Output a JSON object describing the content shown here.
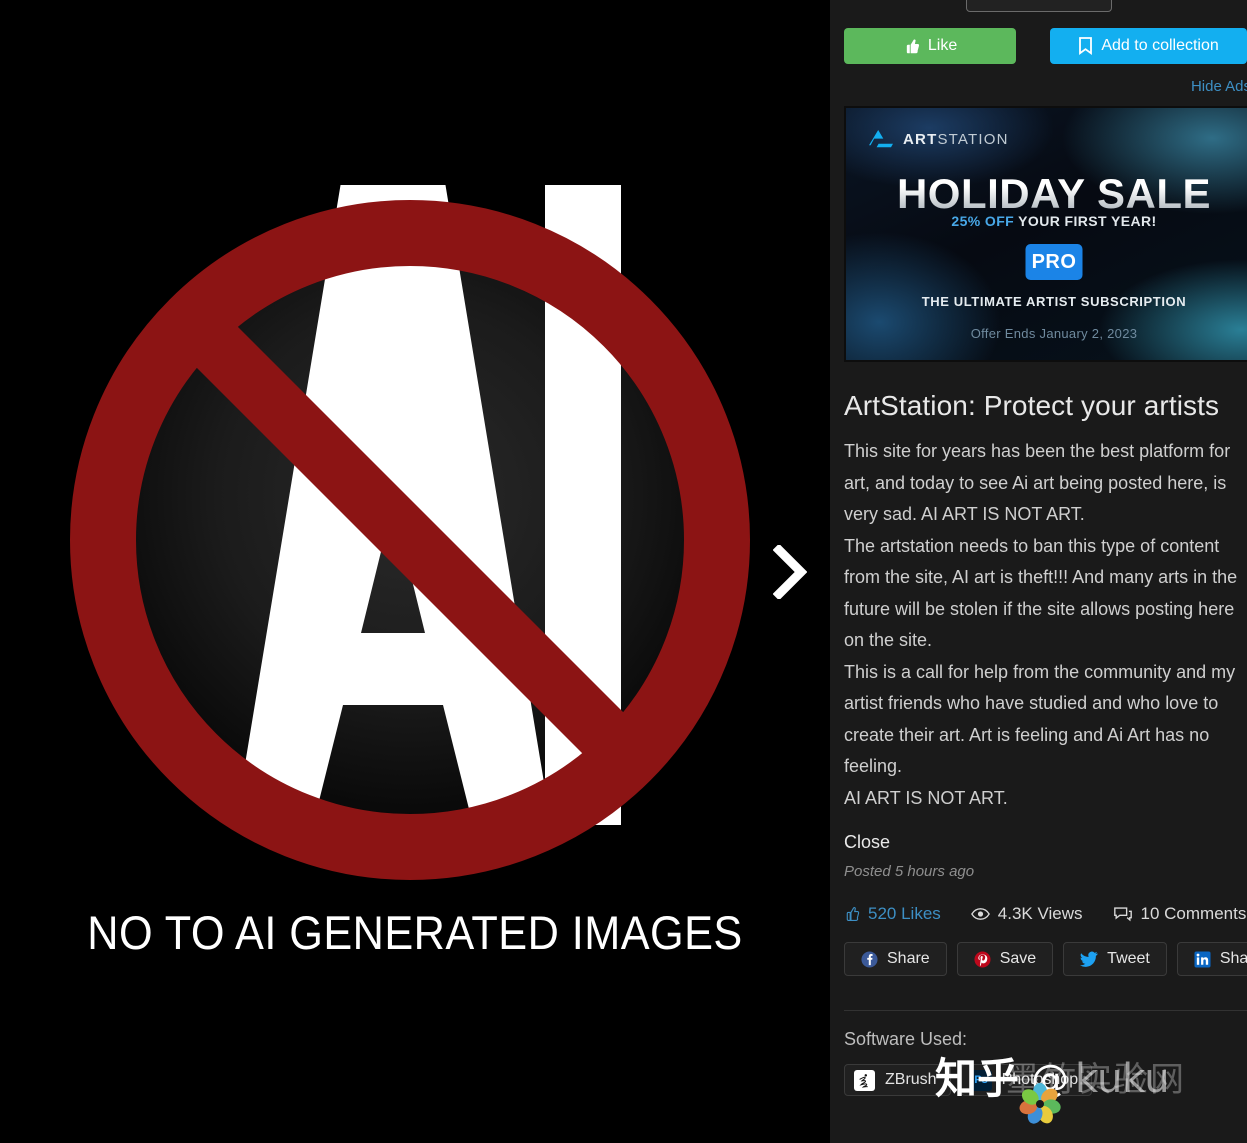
{
  "artwork": {
    "caption": "NO TO AI GENERATED IMAGES",
    "symbol_letters": "AI",
    "ban_color": "#8c1414",
    "letter_color": "#ffffff",
    "background_color": "#000000",
    "next_arrow": "chevron-right"
  },
  "sidebar": {
    "actions": {
      "like_label": "Like",
      "like_color": "#5cb85c",
      "collection_label": "Add to collection",
      "collection_color": "#13aff0"
    },
    "hide_ads_label": "Hide Ads",
    "ad": {
      "brand_bold": "ART",
      "brand_light": "STATION",
      "headline": "HOLIDAY SALE",
      "discount": "25% OFF",
      "subhead_rest": " YOUR FIRST YEAR!",
      "badge": "PRO",
      "tagline": "THE ULTIMATE ARTIST SUBSCRIPTION",
      "offer_ends": "Offer Ends January 2, 2023"
    },
    "post": {
      "title": "ArtStation: Protect your artists",
      "body": "This site for years has been the best platform for art, and today to see Ai art being posted here, is very sad. AI ART IS NOT ART.\nThe artstation needs to ban this type of content from the site, AI art is theft!!! And many arts in the future will be stolen if the site allows posting here on the site.\nThis is a call for help from the community and my artist friends who have studied and who love to create their art. Art is feeling and Ai Art has no feeling.\nAI ART IS NOT ART.",
      "close_label": "Close",
      "posted": "Posted 5 hours ago"
    },
    "stats": [
      {
        "icon": "thumbs-up-icon",
        "label": "520 Likes",
        "link": true
      },
      {
        "icon": "eye-icon",
        "label": "4.3K Views",
        "link": false
      },
      {
        "icon": "comments-icon",
        "label": "10 Comments",
        "link": false
      }
    ],
    "social": [
      {
        "icon": "facebook-icon",
        "label": "Share",
        "color": "#3b5998"
      },
      {
        "icon": "pinterest-icon",
        "label": "Save",
        "color": "#bd081c"
      },
      {
        "icon": "twitter-icon",
        "label": "Tweet",
        "color": "#1da1f2"
      },
      {
        "icon": "linkedin-icon",
        "label": "Share",
        "color": "#0a66c2"
      }
    ],
    "software": {
      "label": "Software Used:",
      "items": [
        {
          "icon": "zbrush-icon",
          "label": "ZBrush"
        },
        {
          "icon": "photoshop-icon",
          "label": "Photoshop",
          "badge": "Ps"
        }
      ]
    }
  },
  "watermark": {
    "platform": "知乎",
    "at": "@",
    "handle": "kuku",
    "overlay_cn": "墨竹实验网"
  }
}
